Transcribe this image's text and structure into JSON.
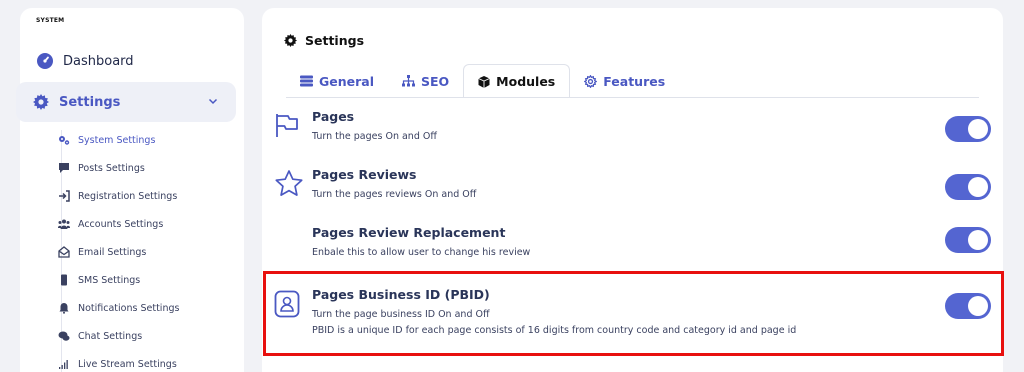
{
  "sidebar": {
    "section_label": "SYSTEM",
    "dashboard": {
      "label": "Dashboard",
      "icon": "dashboard-icon"
    },
    "settings": {
      "label": "Settings",
      "icon": "gear-icon"
    },
    "sub_items": [
      {
        "label": "System Settings",
        "icon": "gears-icon",
        "active": true
      },
      {
        "label": "Posts Settings",
        "icon": "comment-icon"
      },
      {
        "label": "Registration Settings",
        "icon": "sign-in-icon"
      },
      {
        "label": "Accounts Settings",
        "icon": "users-icon"
      },
      {
        "label": "Email Settings",
        "icon": "envelope-icon"
      },
      {
        "label": "SMS Settings",
        "icon": "mobile-icon"
      },
      {
        "label": "Notifications Settings",
        "icon": "bell-icon"
      },
      {
        "label": "Chat Settings",
        "icon": "chat-icon"
      },
      {
        "label": "Live Stream Settings",
        "icon": "signal-icon"
      }
    ]
  },
  "main": {
    "title": "Settings",
    "tabs": [
      {
        "label": "General",
        "icon": "bars-icon"
      },
      {
        "label": "SEO",
        "icon": "sitemap-icon"
      },
      {
        "label": "Modules",
        "icon": "cube-icon",
        "active": true
      },
      {
        "label": "Features",
        "icon": "cog-icon"
      }
    ],
    "rows": [
      {
        "title": "Pages",
        "desc": "Turn the pages On and Off",
        "icon": "flag-icon",
        "enabled": true
      },
      {
        "title": "Pages Reviews",
        "desc": "Turn the pages reviews On and Off",
        "icon": "star-icon",
        "enabled": true
      },
      {
        "title": "Pages Review Replacement",
        "desc": "Enbale this to allow user to change his review",
        "enabled": true
      },
      {
        "title": "Pages Business ID (PBID)",
        "desc": "Turn the page business ID On and Off",
        "desc2": "PBID is a unique ID for each page consists of 16 digits from country code and category id and page id",
        "icon": "id-badge-icon",
        "enabled": true
      }
    ]
  },
  "colors": {
    "accent": "#5465d1",
    "highlight": "#e8100e"
  }
}
